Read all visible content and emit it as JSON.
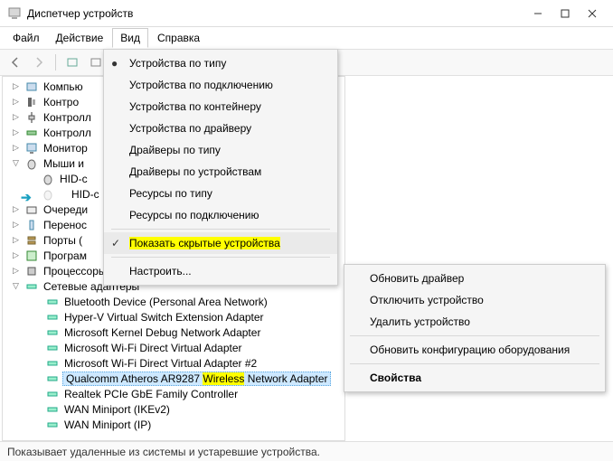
{
  "window": {
    "title": "Диспетчер устройств"
  },
  "menubar": {
    "file": "Файл",
    "action": "Действие",
    "view": "Вид",
    "help": "Справка"
  },
  "view_menu": {
    "by_type": "Устройства по типу",
    "by_connection": "Устройства по подключению",
    "by_container": "Устройства по контейнеру",
    "by_driver": "Устройства по драйверу",
    "drv_by_type": "Драйверы по типу",
    "drv_by_device": "Драйверы по устройствам",
    "res_by_type": "Ресурсы по типу",
    "res_by_conn": "Ресурсы по подключению",
    "show_hidden": "Показать скрытые устройства",
    "customize": "Настроить..."
  },
  "tree": {
    "n0": "Компью",
    "n1": "Контро",
    "n2": "Контролл",
    "n3": "Контролл",
    "n4": "Монитор",
    "n5": "Мыши и",
    "n5a": "HID-с",
    "n5b": "HID-с",
    "n6": "Очереди",
    "n7": "Перенос",
    "n8": "Порты (",
    "n9": "Програм",
    "n10": "Процессоры",
    "n11": "Сетевые адаптеры",
    "a0": "Bluetooth Device (Personal Area Network)",
    "a1": "Hyper-V Virtual Switch Extension Adapter",
    "a2": "Microsoft Kernel Debug Network Adapter",
    "a3": "Microsoft Wi-Fi Direct Virtual Adapter",
    "a4": "Microsoft Wi-Fi Direct Virtual Adapter #2",
    "a5_pre": "Qualcomm Atheros AR9287 ",
    "a5_hl": "Wireless",
    "a5_post": " Network Adapter",
    "a6": "Realtek PCIe GbE Family Controller",
    "a7": "WAN Miniport (IKEv2)",
    "a8": "WAN Miniport (IP)"
  },
  "ctx": {
    "update": "Обновить драйвер",
    "disable": "Отключить устройство",
    "uninstall": "Удалить устройство",
    "scan": "Обновить конфигурацию оборудования",
    "props": "Свойства"
  },
  "status": {
    "text": "Показывает удаленные из системы и устаревшие устройства."
  }
}
